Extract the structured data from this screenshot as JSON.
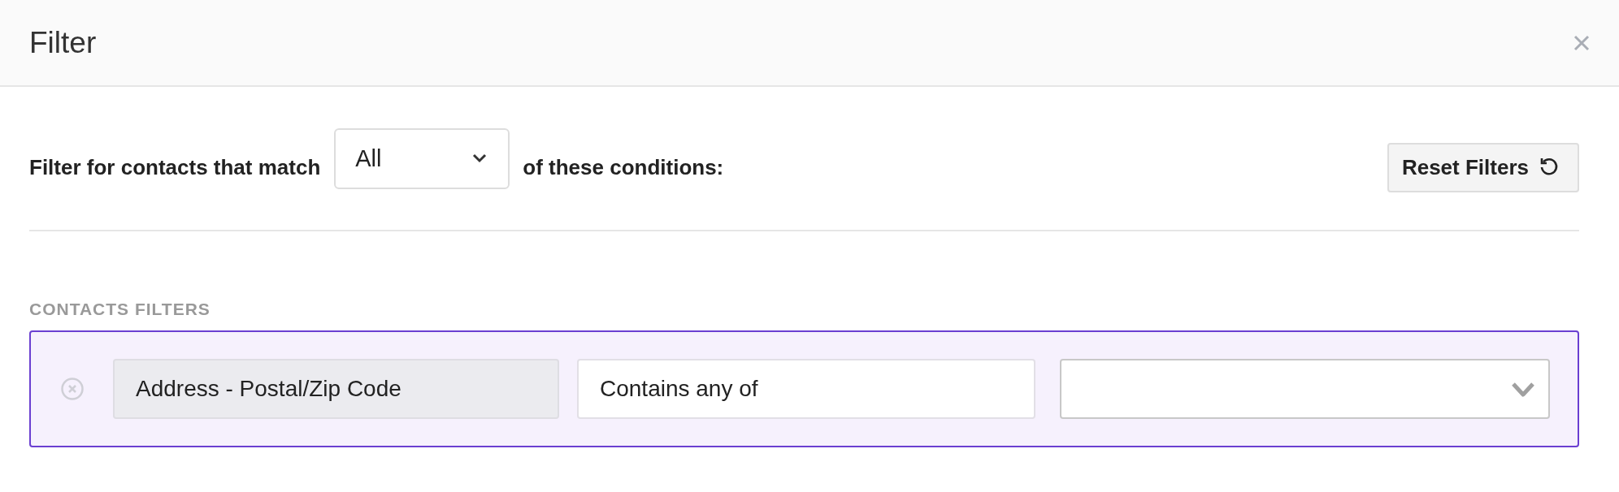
{
  "dialog": {
    "title": "Filter"
  },
  "match": {
    "prefix": "Filter for contacts that match",
    "mode": "All",
    "suffix": "of these conditions:"
  },
  "reset_button": {
    "label": "Reset Filters"
  },
  "section": {
    "heading": "CONTACTS FILTERS"
  },
  "filters": [
    {
      "field": "Address - Postal/Zip Code",
      "operator": "Contains any of",
      "active": true
    }
  ]
}
